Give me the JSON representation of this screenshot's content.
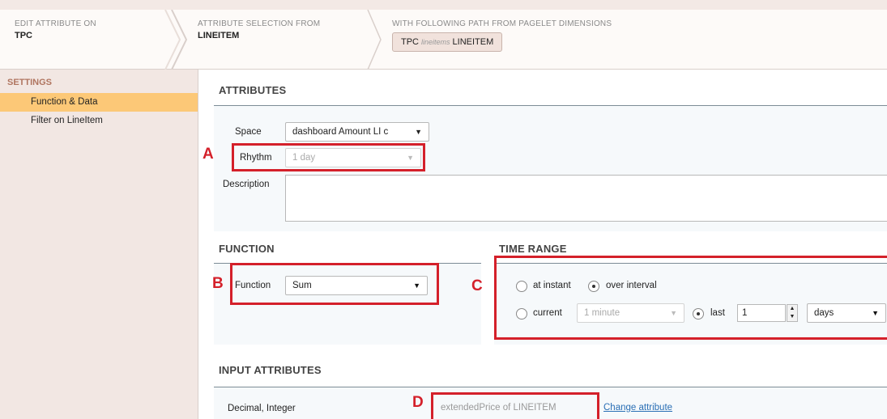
{
  "header": {
    "crumb1": {
      "caption": "EDIT ATTRIBUTE ON",
      "value": "TPC"
    },
    "crumb2": {
      "caption": "ATTRIBUTE SELECTION FROM",
      "value": "LINEITEM"
    },
    "crumb3": {
      "caption": "WITH FOLLOWING PATH FROM PAGELET DIMENSIONS",
      "path_start": "TPC",
      "path_mid": "lineitems",
      "path_end": "LINEITEM"
    }
  },
  "sidebar": {
    "heading": "SETTINGS",
    "items": [
      {
        "label": "Function & Data",
        "active": true
      },
      {
        "label": "Filter on LineItem",
        "active": false
      }
    ]
  },
  "attributes": {
    "title": "ATTRIBUTES",
    "space_label": "Space",
    "space_value": "dashboard Amount LI c",
    "rhythm_label": "Rhythm",
    "rhythm_value": "1 day",
    "description_label": "Description",
    "description_value": ""
  },
  "function": {
    "title": "FUNCTION",
    "label": "Function",
    "value": "Sum"
  },
  "time_range": {
    "title": "TIME RANGE",
    "at_instant": "at instant",
    "over_interval": "over interval",
    "current": "current",
    "current_value": "1 minute",
    "last": "last",
    "last_value": "1",
    "unit_value": "days"
  },
  "input_attributes": {
    "title": "INPUT ATTRIBUTES",
    "type_label": "Decimal, Integer",
    "attribute_value": "extendedPrice of LINEITEM",
    "change_link": "Change attribute"
  },
  "annotations": {
    "a": "A",
    "b": "B",
    "c": "C",
    "d": "D"
  },
  "colors": {
    "accent": "#fcc877",
    "annotation": "#d4202a",
    "link": "#2a6fb5"
  },
  "icons": [
    "chevron-down-icon",
    "breadcrumb-separator-icon",
    "spinner-up-icon",
    "spinner-down-icon"
  ]
}
